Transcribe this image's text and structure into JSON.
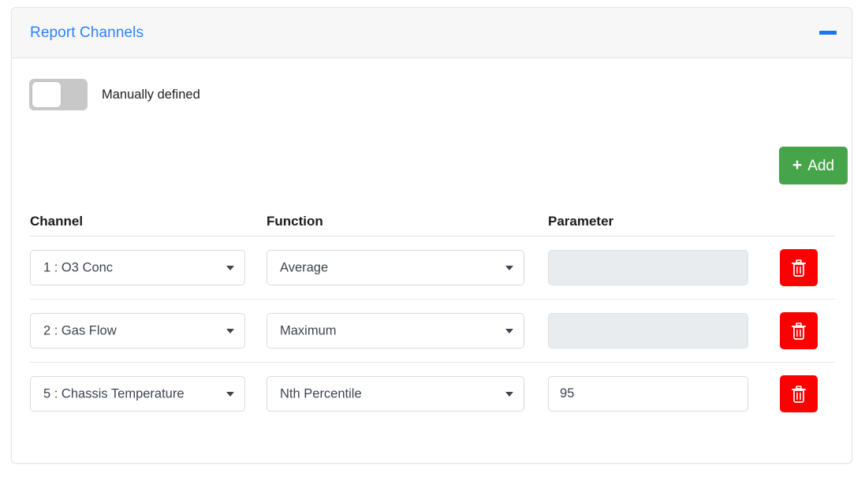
{
  "panel": {
    "title": "Report Channels",
    "collapse_icon": "minus-icon",
    "accent_color": "#2f80ff"
  },
  "toggle": {
    "label": "Manually defined",
    "state": "off"
  },
  "add_button": {
    "label": "Add",
    "icon": "plus-icon",
    "color": "#46a54a"
  },
  "table": {
    "headers": {
      "channel": "Channel",
      "function": "Function",
      "parameter": "Parameter"
    },
    "rows": [
      {
        "channel": "1 : O3 Conc",
        "function": "Average",
        "parameter": "",
        "parameter_enabled": false,
        "delete_icon": "trash-icon"
      },
      {
        "channel": "2 : Gas Flow",
        "function": "Maximum",
        "parameter": "",
        "parameter_enabled": false,
        "delete_icon": "trash-icon"
      },
      {
        "channel": "5 : Chassis Temperature",
        "function": "Nth Percentile",
        "parameter": "95",
        "parameter_enabled": true,
        "delete_icon": "trash-icon"
      }
    ]
  },
  "colors": {
    "delete_button": "#fa0000",
    "disabled_field": "#e9ecef",
    "header_background": "#f7f7f7"
  }
}
